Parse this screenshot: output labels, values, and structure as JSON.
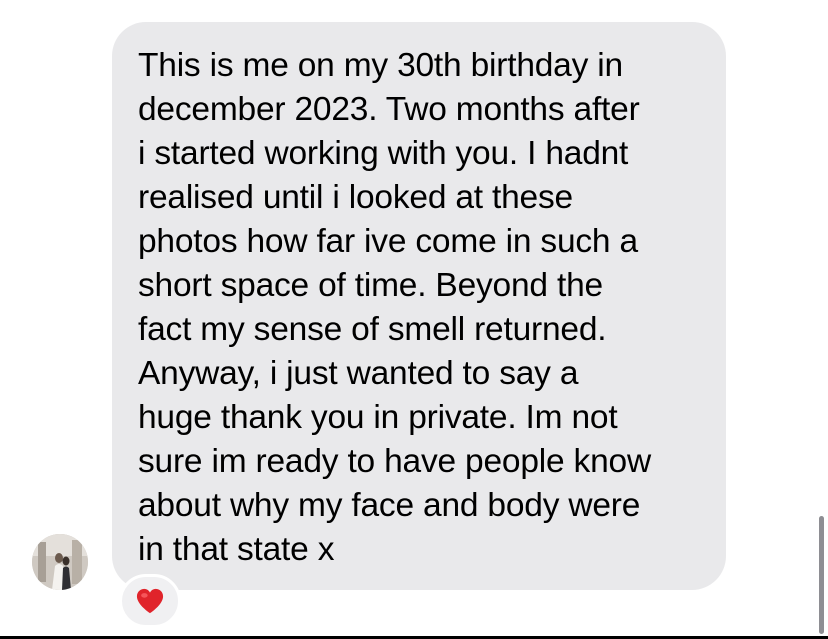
{
  "conversation": {
    "message": {
      "lines": [
        "This is me on my 30th birthday in",
        "december 2023. Two months after",
        "i started working with you. I hadnt",
        "realised until i looked at these",
        "photos how far ive come in such a",
        "short space of time. Beyond the",
        "fact my sense of smell returned.",
        "Anyway, i just wanted to say a",
        "huge thank you in private. Im not",
        "sure im ready to have people know",
        "about why my face and body were",
        "in that state x"
      ],
      "bubble_color": "#e9e9eb",
      "text_color": "#000000"
    },
    "sender_avatar": {
      "icon": "profile-photo-icon"
    },
    "reaction": {
      "icon": "red-heart-icon",
      "color": "#e0242b"
    }
  }
}
